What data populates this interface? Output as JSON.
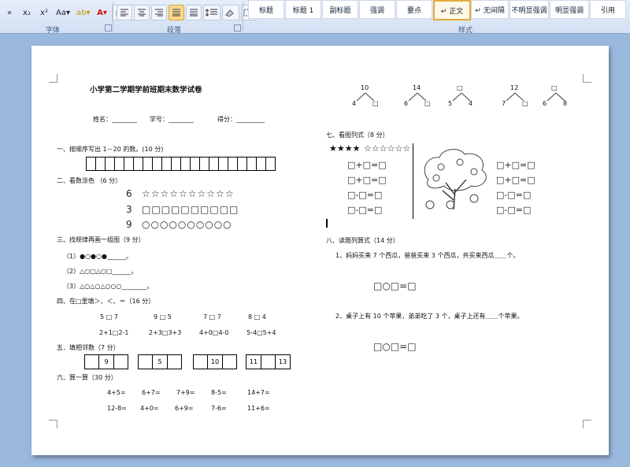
{
  "ribbon": {
    "font_group_label": "字体",
    "paragraph_group_label": "段落",
    "styles_group_label": "样式",
    "font_buttons": [
      "«",
      "x₂",
      "x²",
      "Aa▾",
      "ab▾",
      "A▾",
      "Ⓐ",
      "A"
    ],
    "styles": [
      "标题",
      "标题 1",
      "副标题",
      "强调",
      "要点",
      "↵ 正文",
      "↵ 无间隔",
      "不明显强调",
      "明显强调",
      "引用"
    ]
  },
  "doc": {
    "title": "小学第二学期学前班期末数学试卷",
    "name_line": "姓名：________",
    "id_line": "学号：________",
    "score_line": "得分：_________",
    "s1": "一、按顺序写出 1－20 的数。(10 分)",
    "s2": "二、看数涂色 （6 分）",
    "color_rows": [
      {
        "num": "6",
        "glyphs": "☆☆☆☆☆☆☆☆☆☆"
      },
      {
        "num": "3",
        "glyphs": "□□□□□□□□□□"
      },
      {
        "num": "9",
        "glyphs": "○○○○○○○○○○"
      }
    ],
    "s3": "三、找规律再画一组图（9 分）",
    "pattern1": "（1）●○●○●______。",
    "pattern2": "（2）△○□△○□______。",
    "pattern3": "（3）△○△○△○○○________。",
    "s4": "四、在□里填＞、＜、＝（16 分）",
    "compare_row1": [
      "5 □ 7",
      "9 □ 5",
      "7 □ 7",
      "8 □ 4"
    ],
    "compare_row2": [
      "2+1□2-1",
      "2+3□3+3",
      "4+0□4-0",
      "5-4□5+4"
    ],
    "s5": "五．填相邻数（7 分）",
    "neighbors": [
      "9",
      "5",
      "10",
      "11",
      "13"
    ],
    "s6": "六、算一算（30 分）",
    "calc_row1": [
      "4+5=",
      "6+7=",
      "7+9=",
      "8-5=",
      "14+7="
    ],
    "calc_row2": [
      "12-8=",
      "4+0=",
      "6+9=",
      "7-6=",
      "11+6="
    ],
    "trees": [
      {
        "top": "10",
        "left": "4",
        "right": "□"
      },
      {
        "top": "14",
        "left": "6",
        "right": "□"
      },
      {
        "top": "□",
        "left": "5",
        "right": "4"
      },
      {
        "top": "12",
        "left": "7",
        "right": "□"
      },
      {
        "top": "□",
        "left": "6",
        "right": "8"
      }
    ],
    "s7": "七、看图列式（8 分）",
    "stars_filled": "★★★★",
    "stars_empty": "☆☆☆☆☆☆",
    "eq_left": [
      "□+□=□",
      "□+□=□",
      "□-□=□",
      "□-□=□"
    ],
    "eq_right": [
      "□+□=□",
      "□+□=□",
      "□-□=□",
      "□-□=□"
    ],
    "s8": "八、读题列算式（14 分）",
    "q1": "1、妈妈买来 7 个西瓜，爸爸买来 3 个西瓜，共买来西瓜＿＿个。",
    "q1_eq": "□○□=□",
    "q2": "2、桌子上有 10 个苹果，弟弟吃了 3 个，桌子上还有＿＿个苹果。",
    "q2_eq": "□○□=□"
  }
}
